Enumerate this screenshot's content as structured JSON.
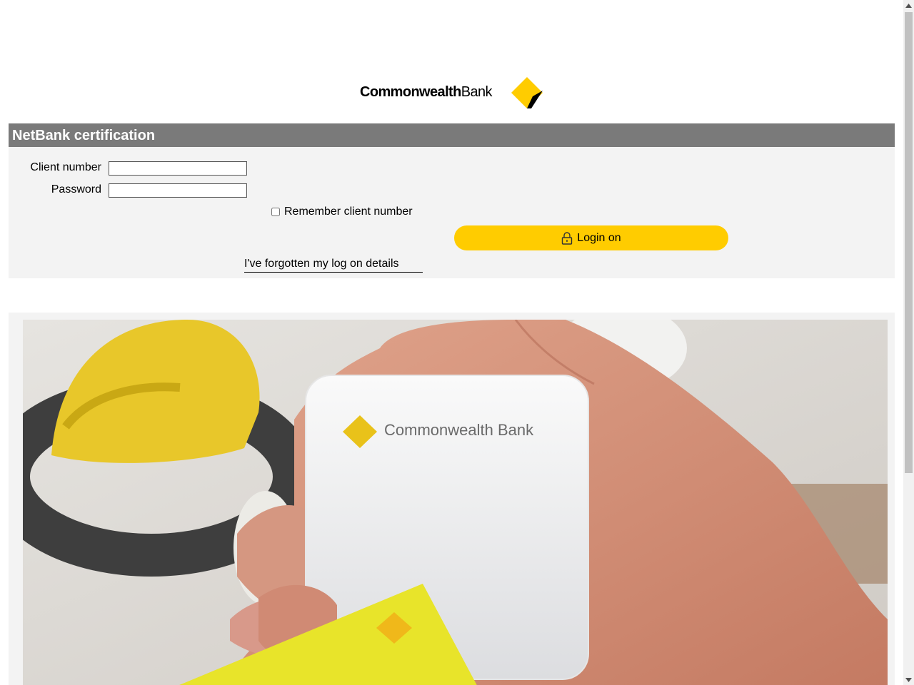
{
  "logo": {
    "brand_bold": "Commonwealth",
    "brand_light": "Bank",
    "accent_color": "#ffcc00"
  },
  "header": {
    "title": "NetBank certification",
    "bar_color": "#7a7a7a"
  },
  "form": {
    "client_label": "Client number",
    "client_value": "",
    "password_label": "Password",
    "password_value": "",
    "remember_label": "Remember client number",
    "remember_checked": false,
    "login_label": "Login on",
    "login_icon": "padlock-icon",
    "forgot_link": "I've forgotten my log on details",
    "button_color": "#ffcc00",
    "panel_color": "#f3f3f3"
  },
  "promo": {
    "card_brand_text": "Commonwealth Bank"
  }
}
